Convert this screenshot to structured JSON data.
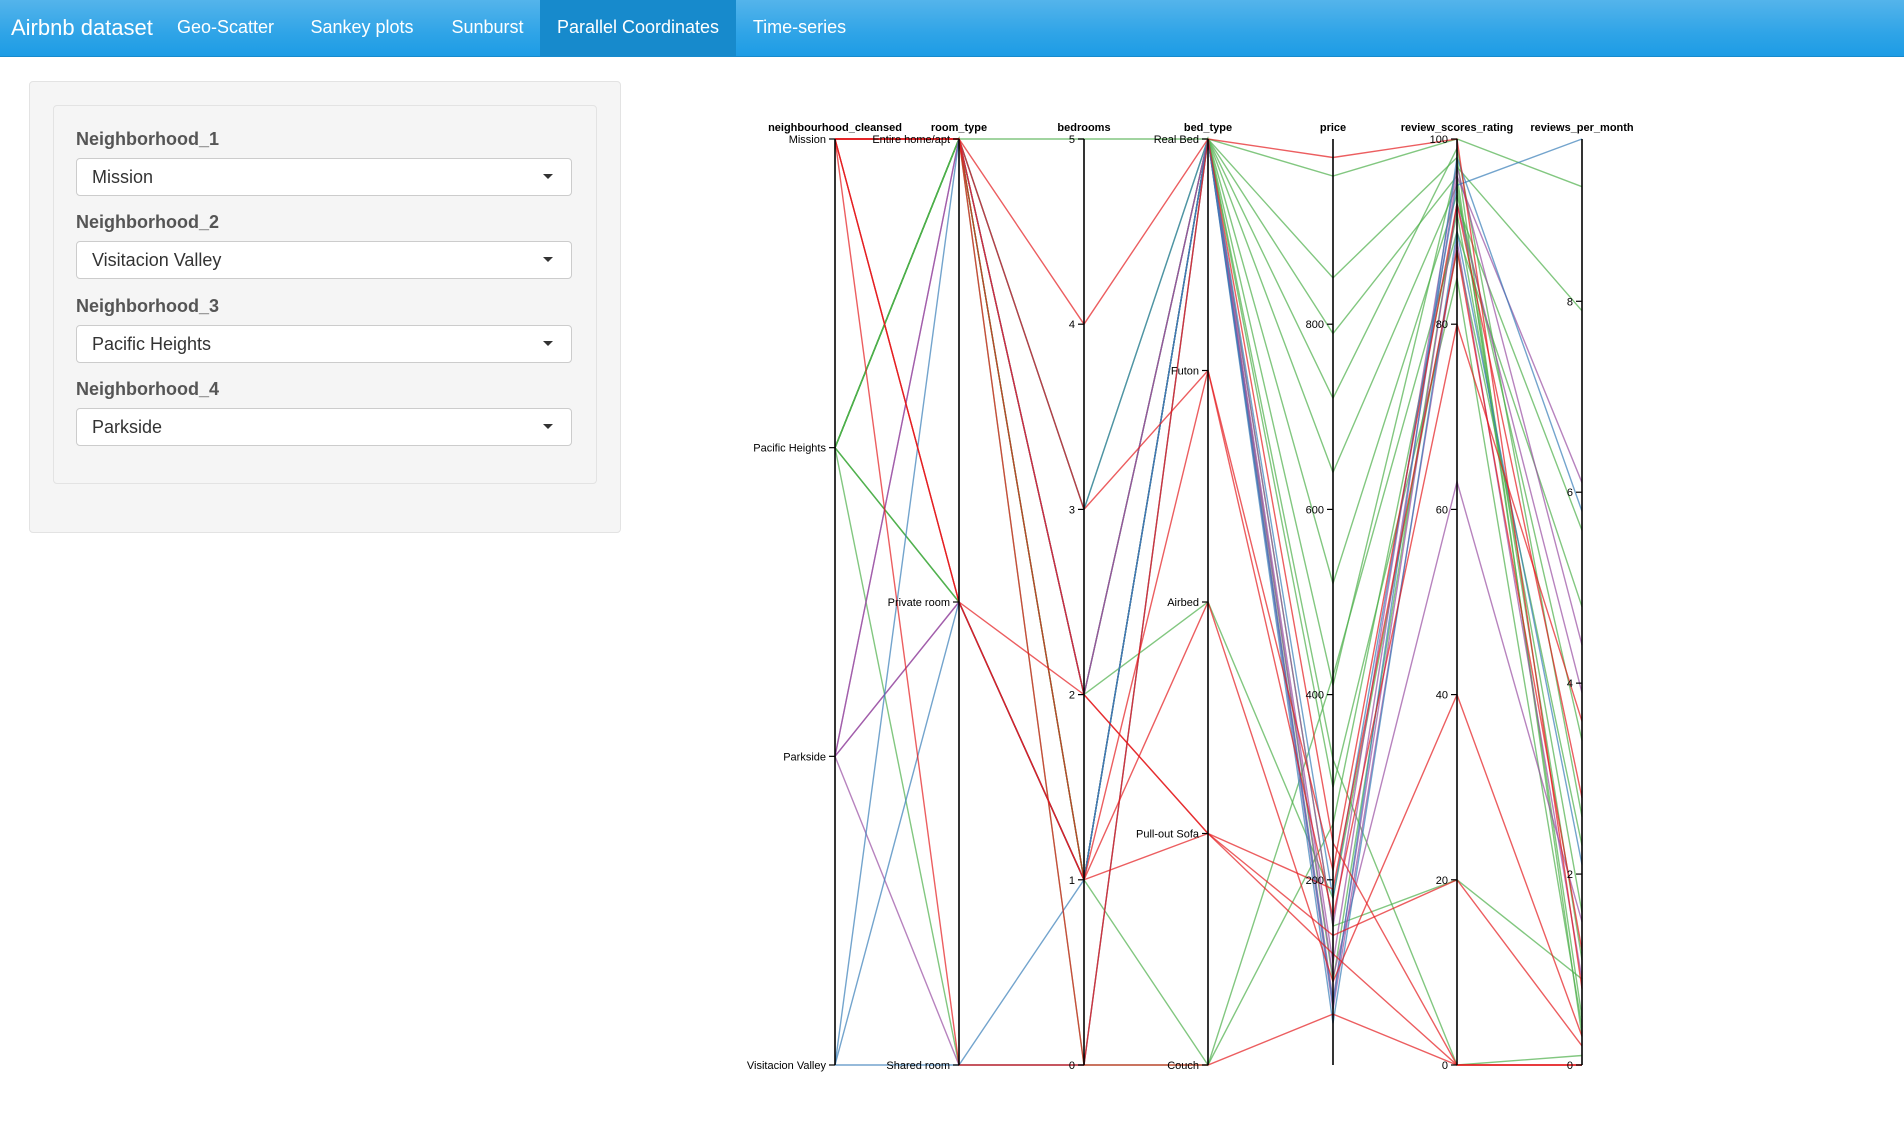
{
  "app": {
    "brand": "Airbnb dataset",
    "tabs": [
      {
        "label": "Geo-Scatter",
        "active": false
      },
      {
        "label": "Sankey plots",
        "active": false
      },
      {
        "label": "Sunburst",
        "active": false
      },
      {
        "label": "Parallel Coordinates",
        "active": true
      },
      {
        "label": "Time-series",
        "active": false
      }
    ],
    "accent_color": "#2fa4e7"
  },
  "sidebar": {
    "fields": [
      {
        "label": "Neighborhood_1",
        "value": "Mission"
      },
      {
        "label": "Neighborhood_2",
        "value": "Visitacion Valley"
      },
      {
        "label": "Neighborhood_3",
        "value": "Pacific Heights"
      },
      {
        "label": "Neighborhood_4",
        "value": "Parkside"
      }
    ]
  },
  "chart_data": {
    "type": "parallel-coordinates",
    "axes": [
      {
        "name": "neighbourhood_cleansed",
        "type": "categorical",
        "categories": [
          "Mission",
          "Pacific Heights",
          "Parkside",
          "Visitacion Valley"
        ]
      },
      {
        "name": "room_type",
        "type": "categorical",
        "categories": [
          "Entire home/apt",
          "Private room",
          "Shared room"
        ]
      },
      {
        "name": "bedrooms",
        "type": "numeric",
        "range": [
          0,
          5
        ],
        "ticks": [
          0,
          1,
          2,
          3,
          4,
          5
        ]
      },
      {
        "name": "bed_type",
        "type": "categorical",
        "categories": [
          "Real Bed",
          "Futon",
          "Airbed",
          "Pull-out Sofa",
          "Couch"
        ]
      },
      {
        "name": "price",
        "type": "numeric",
        "range": [
          0,
          1000
        ],
        "ticks": [
          200,
          400,
          600,
          800
        ]
      },
      {
        "name": "review_scores_rating",
        "type": "numeric",
        "range": [
          0,
          100
        ],
        "ticks": [
          0,
          20,
          40,
          60,
          80,
          100
        ]
      },
      {
        "name": "reviews_per_month",
        "type": "numeric",
        "range": [
          0,
          9.7
        ],
        "ticks": [
          0,
          2,
          4,
          6,
          8
        ]
      }
    ],
    "colors": {
      "Mission": "#e41a1c",
      "Pacific Heights": "#4daf4a",
      "Parkside": "#984ea3",
      "Visitacion Valley": "#377eb8"
    },
    "records": [
      [
        "Pacific Heights",
        "Entire home/apt",
        5,
        "Real Bed",
        960,
        100,
        9.2
      ],
      [
        "Pacific Heights",
        "Entire home/apt",
        1,
        "Real Bed",
        850,
        98,
        0.3
      ],
      [
        "Pacific Heights",
        "Private room",
        1,
        "Real Bed",
        790,
        96,
        0.5
      ],
      [
        "Pacific Heights",
        "Entire home/apt",
        1,
        "Real Bed",
        640,
        95,
        1.1
      ],
      [
        "Pacific Heights",
        "Private room",
        1,
        "Couch",
        260,
        92,
        1.6
      ],
      [
        "Pacific Heights",
        "Entire home/apt",
        2,
        "Airbed",
        180,
        88,
        2.3
      ],
      [
        "Pacific Heights",
        "Shared room",
        0,
        "Real Bed",
        520,
        94,
        3.4
      ],
      [
        "Pacific Heights",
        "Entire home/apt",
        0,
        "Couch",
        420,
        90,
        4.8
      ],
      [
        "Pacific Heights",
        "Entire home/apt",
        2,
        "Real Bed",
        410,
        97,
        7.9
      ],
      [
        "Pacific Heights",
        "Private room",
        1,
        "Real Bed",
        150,
        20,
        0.9
      ],
      [
        "Pacific Heights",
        "Entire home/apt",
        3,
        "Real Bed",
        330,
        0,
        0.1
      ],
      [
        "Pacific Heights",
        "Entire home/apt",
        1,
        "Real Bed",
        300,
        85,
        0.4
      ],
      [
        "Pacific Heights",
        "Entire home/apt",
        2,
        "Real Bed",
        720,
        99,
        2.6
      ],
      [
        "Pacific Heights",
        "Entire home/apt",
        1,
        "Real Bed",
        90,
        93,
        5.6
      ],
      [
        "Parkside",
        "Entire home/apt",
        2,
        "Real Bed",
        110,
        96,
        6.1
      ],
      [
        "Parkside",
        "Private room",
        1,
        "Real Bed",
        70,
        93,
        3.9
      ],
      [
        "Parkside",
        "Shared room",
        0,
        "Real Bed",
        60,
        89,
        0.9
      ],
      [
        "Parkside",
        "Private room",
        1,
        "Real Bed",
        95,
        63,
        1.5
      ],
      [
        "Parkside",
        "Entire home/apt",
        2,
        "Real Bed",
        150,
        97,
        4.4
      ],
      [
        "Visitacion Valley",
        "Entire home/apt",
        3,
        "Real Bed",
        180,
        95,
        9.7
      ],
      [
        "Visitacion Valley",
        "Private room",
        1,
        "Real Bed",
        65,
        98,
        5.8
      ],
      [
        "Visitacion Valley",
        "Shared room",
        1,
        "Real Bed",
        45,
        90,
        2.1
      ],
      [
        "Mission",
        "Entire home/apt",
        4,
        "Real Bed",
        980,
        100,
        0.8
      ],
      [
        "Mission",
        "Entire home/apt",
        3,
        "Futon",
        210,
        93,
        2.8
      ],
      [
        "Mission",
        "Entire home/apt",
        2,
        "Pull-out Sofa",
        190,
        88,
        1.2
      ],
      [
        "Mission",
        "Private room",
        1,
        "Pull-out Sofa",
        120,
        0,
        0.0
      ],
      [
        "Mission",
        "Private room",
        1,
        "Airbed",
        90,
        40,
        0.3
      ],
      [
        "Mission",
        "Shared room",
        0,
        "Couch",
        55,
        0,
        0.0
      ],
      [
        "Mission",
        "Private room",
        2,
        "Pull-out Sofa",
        140,
        20,
        0.2
      ],
      [
        "Mission",
        "Entire home/apt",
        1,
        "Futon",
        160,
        80,
        3.6
      ],
      [
        "Mission",
        "Entire home/apt",
        0,
        "Real Bed",
        240,
        0,
        0.0
      ]
    ]
  }
}
